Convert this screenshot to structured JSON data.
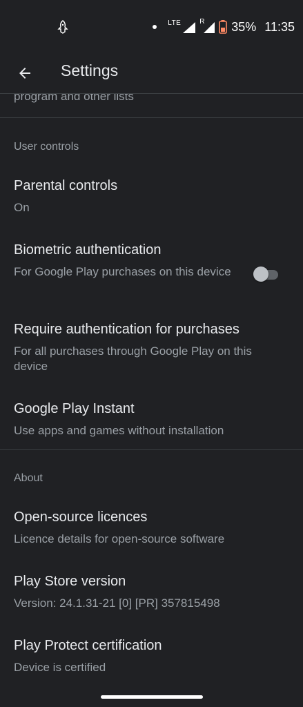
{
  "status_bar": {
    "network_type": "LTE",
    "roaming_indicator": "R",
    "battery_percent": "35%",
    "time": "11:35",
    "icons": [
      "notification-bird-icon",
      "dot-icon",
      "lte-signal-icon",
      "roaming-signal-icon",
      "battery-icon"
    ]
  },
  "app_bar": {
    "title": "Settings",
    "back_icon": "arrow-left-icon"
  },
  "partial_text": "program and other lists",
  "sections": {
    "user_controls": {
      "header": "User controls",
      "parental_controls": {
        "title": "Parental controls",
        "subtitle": "On"
      },
      "biometric": {
        "title": "Biometric authentication",
        "subtitle": "For Google Play purchases on this device",
        "toggle_state": "off"
      },
      "require_auth": {
        "title": "Require authentication for purchases",
        "subtitle": "For all purchases through Google Play on this device"
      },
      "play_instant": {
        "title": "Google Play Instant",
        "subtitle": "Use apps and games without installation"
      }
    },
    "about": {
      "header": "About",
      "open_source": {
        "title": "Open-source licences",
        "subtitle": "Licence details for open-source software"
      },
      "version": {
        "title": "Play Store version",
        "subtitle": "Version: 24.1.31-21 [0] [PR] 357815498"
      },
      "protect": {
        "title": "Play Protect certification",
        "subtitle": "Device is certified"
      }
    }
  },
  "colors": {
    "background": "#202124",
    "primary_text": "#e8eaed",
    "secondary_text": "#9aa0a6",
    "divider": "#3c4043"
  }
}
